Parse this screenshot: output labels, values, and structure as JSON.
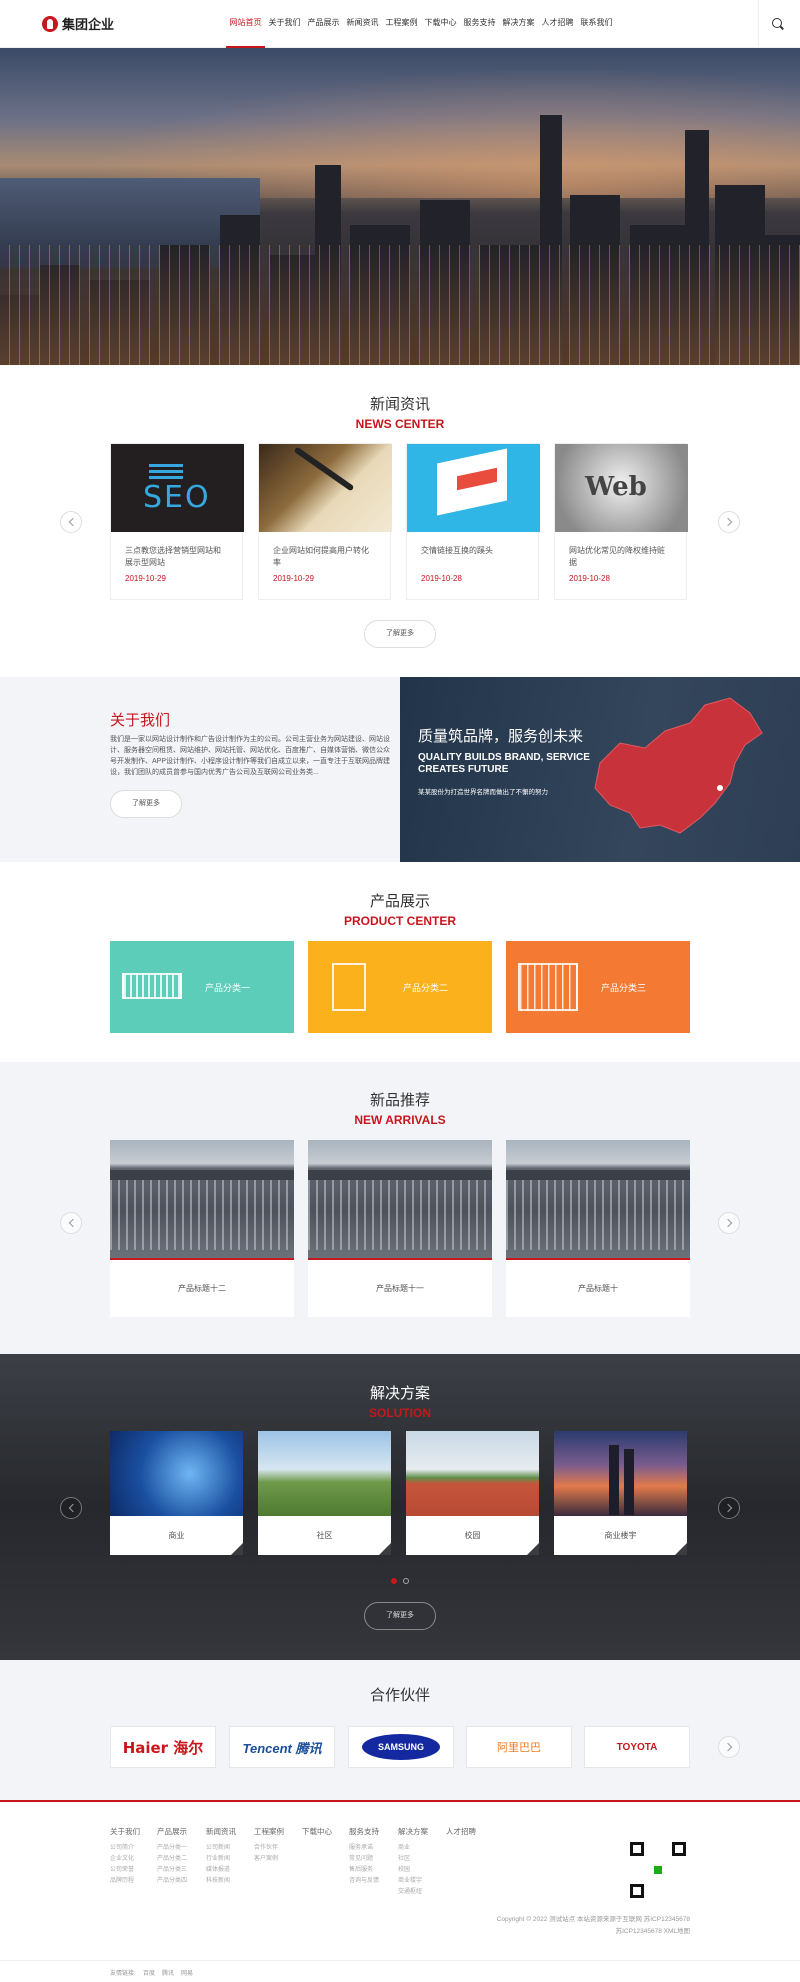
{
  "header": {
    "brand": "集团企业",
    "nav": [
      "网站首页",
      "关于我们",
      "产品展示",
      "新闻资讯",
      "工程案例",
      "下载中心",
      "服务支持",
      "解决方案",
      "人才招聘",
      "联系我们"
    ],
    "active_index": 0
  },
  "news": {
    "title_cn": "新闻资讯",
    "title_en": "NEWS CENTER",
    "items": [
      {
        "title": "三点教您选择营销型网站和展示型网站",
        "date": "2019-10-29",
        "image_text": "SEO"
      },
      {
        "title": "企业网站如何提高用户转化率",
        "date": "2019-10-29"
      },
      {
        "title": "交情链接互换的蹊头",
        "date": "2019-10-28"
      },
      {
        "title": "网站优化常见的降权维持赃据",
        "date": "2019-10-28",
        "image_text": "Web"
      }
    ],
    "more": "了解更多"
  },
  "about": {
    "title": "关于我们",
    "text": "我们是一家以网站设计制作和广告设计制作为主的公司。公司主营业务为网站建设、网站设计、服务器空间租赁、网站维护、网站托管、网站优化、百度推广、自媒体营销、微信公众号开发制作、APP设计制作、小程序设计制作等我们自成立以来，一直专注于互联网品牌建设，我们团队的成员曾参与国内优秀广告公司及互联网公司业务类...",
    "more": "了解更多",
    "panel_cn": "质量筑品牌，服务创未来",
    "panel_en": "QUALITY BUILDS BRAND, SERVICE CREATES FUTURE",
    "panel_sub": "某某股份为打造世界名牌而做出了不懈的努力"
  },
  "products": {
    "title_cn": "产品展示",
    "title_en": "PRODUCT CENTER",
    "items": [
      {
        "label": "产品分类一",
        "color": "#5ccdb8"
      },
      {
        "label": "产品分类二",
        "color": "#fbb11b"
      },
      {
        "label": "产品分类三",
        "color": "#f47a34"
      }
    ]
  },
  "arrivals": {
    "title_cn": "新品推荐",
    "title_en": "NEW ARRIVALS",
    "items": [
      "产品标题十二",
      "产品标题十一",
      "产品标题十"
    ]
  },
  "solution": {
    "title_cn": "解决方案",
    "title_en": "SOLUTION",
    "items": [
      "商业",
      "社区",
      "校园",
      "商业楼宇"
    ],
    "more": "了解更多"
  },
  "partners": {
    "title": "合作伙伴",
    "logos": [
      {
        "name": "haier-logo",
        "text": "Haier 海尔",
        "color": "#c8161d"
      },
      {
        "name": "tencent-logo",
        "text": "Tencent 腾讯",
        "color": "#1b4f9b"
      },
      {
        "name": "samsung-logo",
        "text": "SAMSUNG",
        "color": "#1428a0"
      },
      {
        "name": "alibaba-logo",
        "text": "阿里巴巴",
        "color": "#f47a20"
      },
      {
        "name": "toyota-logo",
        "text": "TOYOTA",
        "color": "#c8161d"
      }
    ]
  },
  "footer": {
    "cols": [
      {
        "h": "关于我们",
        "items": [
          "公司简介",
          "企业文化",
          "公司荣誉",
          "品牌历程"
        ]
      },
      {
        "h": "产品展示",
        "items": [
          "产品分类一",
          "产品分类二",
          "产品分类三",
          "产品分类四"
        ]
      },
      {
        "h": "新闻资讯",
        "items": [
          "公司新闻",
          "行业新闻",
          "媒体报道",
          "科技新闻"
        ]
      },
      {
        "h": "工程案例",
        "items": [
          "合作伙伴",
          "客户案例"
        ]
      },
      {
        "h": "下载中心",
        "items": []
      },
      {
        "h": "服务支持",
        "items": [
          "服务承诺",
          "常见问题",
          "售后服务",
          "咨询与反馈"
        ]
      },
      {
        "h": "解决方案",
        "items": [
          "商业",
          "社区",
          "校园",
          "商业楼宇",
          "交通枢纽"
        ]
      },
      {
        "h": "人才招聘",
        "items": []
      }
    ],
    "copyright": "Copyright © 2022 测试站点 本站资源来源于互联网 苏ICP12345678",
    "icp": "苏ICP12345678 XML地图",
    "links_label": "友情链接:",
    "links": [
      "百度",
      "腾讯",
      "网易"
    ]
  }
}
